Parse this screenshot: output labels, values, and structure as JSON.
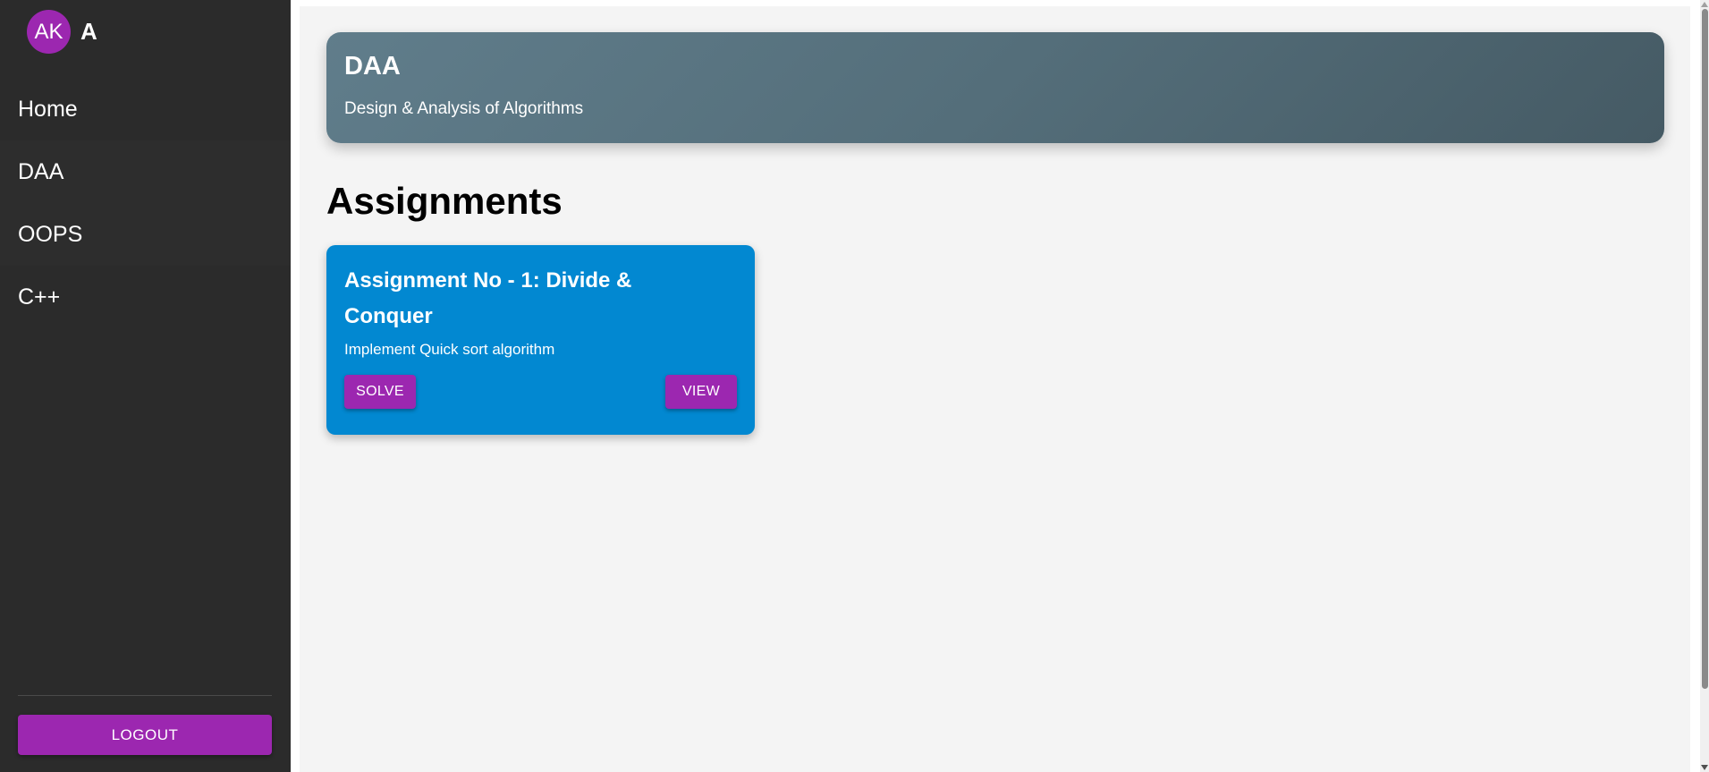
{
  "user": {
    "initials": "AK",
    "name": "A"
  },
  "sidebar": {
    "items": [
      {
        "label": "Home"
      },
      {
        "label": "DAA"
      },
      {
        "label": "OOPS"
      },
      {
        "label": "C++"
      }
    ],
    "logout_label": "LOGOUT"
  },
  "course": {
    "title": "DAA",
    "subtitle": "Design & Analysis of Algorithms"
  },
  "assignments": {
    "heading": "Assignments",
    "items": [
      {
        "title": "Assignment No - 1: Divide & Conquer",
        "description": "Implement Quick sort algorithm",
        "solve_label": "SOLVE",
        "view_label": "VIEW"
      }
    ]
  },
  "colors": {
    "sidebar_bg": "#2b2b2b",
    "accent": "#9c27b0",
    "card_bg": "#0288d1",
    "header_gradient_start": "#607d8b",
    "header_gradient_end": "#455a64",
    "main_bg": "#f4f4f4"
  },
  "icons": {
    "avatar": "avatar-initials",
    "scroll_up": "arrow-up-icon",
    "scroll_down": "arrow-down-icon"
  }
}
